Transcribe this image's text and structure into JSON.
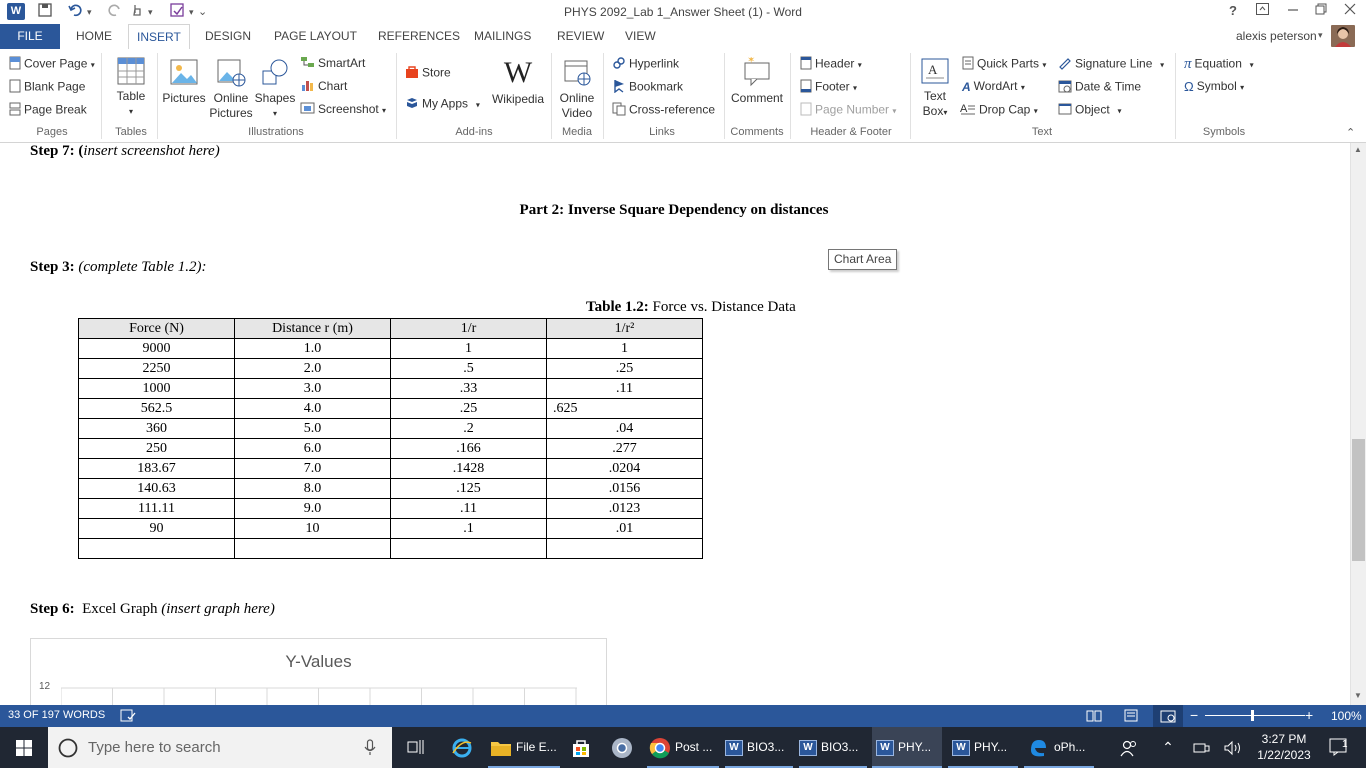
{
  "titlebar": {
    "title": "PHYS 2092_Lab 1_Answer Sheet (1) - Word",
    "help": "?",
    "app_icon": "W"
  },
  "tabs": {
    "file": "FILE",
    "items": [
      "HOME",
      "INSERT",
      "DESIGN",
      "PAGE LAYOUT",
      "REFERENCES",
      "MAILINGS",
      "REVIEW",
      "VIEW"
    ],
    "active": "INSERT",
    "user": "alexis peterson"
  },
  "ribbon": {
    "pages": {
      "label": "Pages",
      "cover_page": "Cover Page",
      "blank_page": "Blank Page",
      "page_break": "Page Break"
    },
    "tables": {
      "label": "Tables",
      "table": "Table"
    },
    "illustrations": {
      "label": "Illustrations",
      "pictures": "Pictures",
      "online_pictures_1": "Online",
      "online_pictures_2": "Pictures",
      "shapes": "Shapes",
      "smartart": "SmartArt",
      "chart": "Chart",
      "screenshot": "Screenshot"
    },
    "addins": {
      "label": "Add-ins",
      "store": "Store",
      "my_apps": "My Apps",
      "wikipedia": "Wikipedia",
      "wikipedia_glyph": "W"
    },
    "media": {
      "label": "Media",
      "online_video_1": "Online",
      "online_video_2": "Video"
    },
    "links": {
      "label": "Links",
      "hyperlink": "Hyperlink",
      "bookmark": "Bookmark",
      "cross_reference": "Cross-reference"
    },
    "comments": {
      "label": "Comments",
      "comment": "Comment"
    },
    "header_footer": {
      "label": "Header & Footer",
      "header": "Header",
      "footer": "Footer",
      "page_number": "Page Number"
    },
    "text": {
      "label": "Text",
      "text_box_1": "Text",
      "text_box_2": "Box",
      "quick_parts": "Quick Parts",
      "wordart": "WordArt",
      "drop_cap": "Drop Cap",
      "signature_line": "Signature Line",
      "date_time": "Date & Time",
      "object": "Object"
    },
    "symbols": {
      "label": "Symbols",
      "equation": "Equation",
      "symbol": "Symbol"
    }
  },
  "document": {
    "step7_bold": "Step 7: (",
    "step7_italic": "insert screenshot here)",
    "part2_title": "Part 2: Inverse Square Dependency on distances",
    "tooltip": "Chart Area",
    "step3_bold": "Step 3:",
    "step3_italic": "(complete Table 1.2):",
    "table_caption_bold": "Table 1.2:",
    "table_caption_rest": "Force vs. Distance Data",
    "table": {
      "headers": [
        "Force (N)",
        "Distance r (m)",
        "1/r",
        "1/r²"
      ],
      "rows": [
        [
          "9000",
          "1.0",
          "1",
          "1"
        ],
        [
          "2250",
          "2.0",
          ".5",
          ".25"
        ],
        [
          "1000",
          "3.0",
          ".33",
          ".11"
        ],
        [
          "562.5",
          "4.0",
          ".25",
          ".625"
        ],
        [
          "360",
          "5.0",
          ".2",
          ".04"
        ],
        [
          "250",
          "6.0",
          ".166",
          ".277"
        ],
        [
          "183.67",
          "7.0",
          ".1428",
          ".0204"
        ],
        [
          "140.63",
          "8.0",
          ".125",
          ".0156"
        ],
        [
          "111.11",
          "9.0",
          ".11",
          ".0123"
        ],
        [
          "90",
          "10",
          ".1",
          ".01"
        ],
        [
          "",
          "",
          "",
          ""
        ]
      ]
    },
    "step6_bold": "Step 6:",
    "step6_text": "Excel Graph",
    "step6_italic": "(insert graph here)",
    "chart_title": "Y-Values",
    "chart_ytick": "12"
  },
  "chart_data": {
    "type": "line",
    "title": "Y-Values",
    "ytick_visible": [
      "12"
    ],
    "grid": true,
    "series": []
  },
  "statusbar": {
    "words": "33 OF 197 WORDS",
    "zoom": "100%",
    "zoom_minus": "−",
    "zoom_plus": "+"
  },
  "taskbar": {
    "search_placeholder": "Type here to search",
    "apps": [
      {
        "label": "File E...",
        "icon": "folder-icon"
      },
      {
        "label": "Post ...",
        "icon": "chrome-icon"
      },
      {
        "label": "BIO3...",
        "icon": "word-icon"
      },
      {
        "label": "BIO3...",
        "icon": "word-icon"
      },
      {
        "label": "PHY...",
        "icon": "word-icon"
      },
      {
        "label": "PHY...",
        "icon": "word-icon"
      },
      {
        "label": "oPh...",
        "icon": "edge-icon"
      }
    ],
    "time": "3:27 PM",
    "date": "1/22/2023",
    "notifications": "1",
    "word_badge": "W"
  }
}
